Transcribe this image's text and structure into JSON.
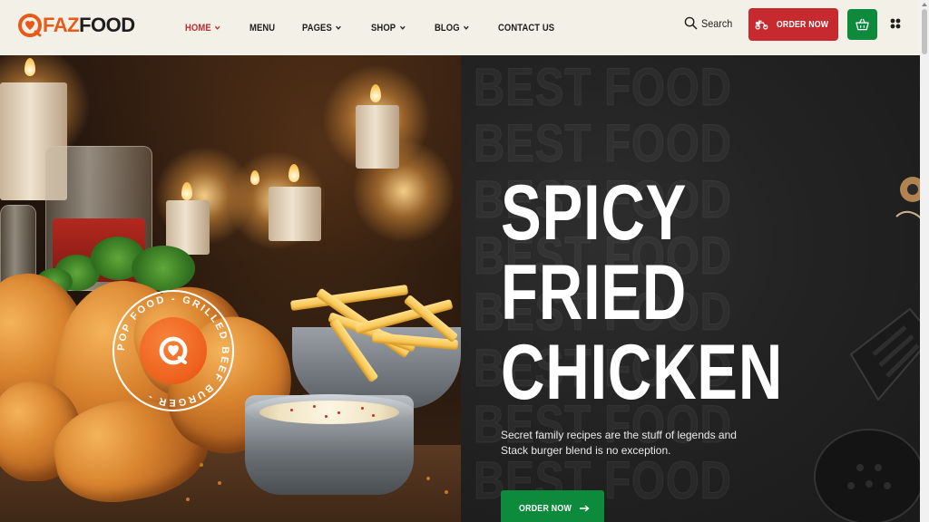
{
  "brand": {
    "name_part1": "FAZ",
    "name_part2": "FOOD",
    "accent_color": "#e8591a",
    "primary_red": "#c62a2f",
    "primary_green": "#0e8a3c"
  },
  "nav": {
    "items": [
      {
        "label": "HOME",
        "has_dropdown": true,
        "active": true
      },
      {
        "label": "MENU",
        "has_dropdown": false,
        "active": false
      },
      {
        "label": "PAGES",
        "has_dropdown": true,
        "active": false
      },
      {
        "label": "SHOP",
        "has_dropdown": true,
        "active": false
      },
      {
        "label": "BLOG",
        "has_dropdown": true,
        "active": false
      },
      {
        "label": "CONTACT US",
        "has_dropdown": false,
        "active": false
      }
    ]
  },
  "header": {
    "search_label": "Search",
    "order_label": "ORDER NOW",
    "icons": [
      "search-icon",
      "delivery-scooter-icon",
      "shopping-basket-icon",
      "grid-menu-icon"
    ]
  },
  "hero": {
    "background_word": "BEST FOOD",
    "title_lines": [
      "SPICY",
      "FRIED",
      "CHICKEN"
    ],
    "description": "Secret family recipes are the stuff of legends and Stack burger blend is no exception.",
    "cta_label": "ORDER NOW",
    "badge_text": "POP FOOD - GRILLED BEEF BURGER -"
  }
}
